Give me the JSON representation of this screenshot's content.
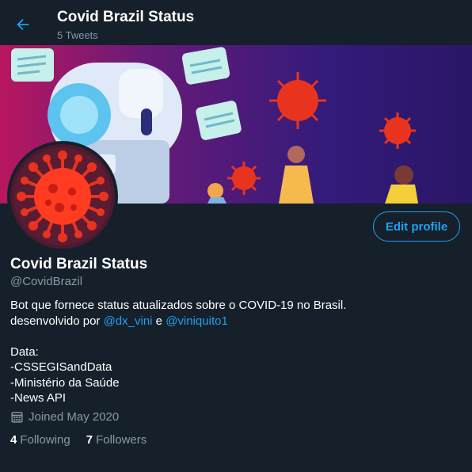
{
  "header": {
    "title": "Covid Brazil Status",
    "subtitle": "5 Tweets"
  },
  "profile": {
    "name": "Covid Brazil Status",
    "handle": "@CovidBrazil",
    "edit_label": "Edit profile",
    "bio": {
      "line1": "Bot que fornece status atualizados sobre o COVID-19 no Brasil.",
      "line2_prefix": "desenvolvido por ",
      "mention1": "@dx_vini",
      "line2_mid": " e ",
      "mention2": "@viniquito1",
      "data_label": "Data:",
      "source1": "-CSSEGISandData",
      "source2": "-Ministério da Saúde",
      "source3": "-News API"
    },
    "joined": "Joined May 2020",
    "following_count": "4",
    "following_label": "Following",
    "followers_count": "7",
    "followers_label": "Followers"
  },
  "colors": {
    "background": "#15202b",
    "accent": "#1da1f2",
    "muted": "#8899a6",
    "virus": "#e8341f"
  },
  "icons": {
    "back": "arrow-left-icon",
    "calendar": "calendar-icon"
  }
}
